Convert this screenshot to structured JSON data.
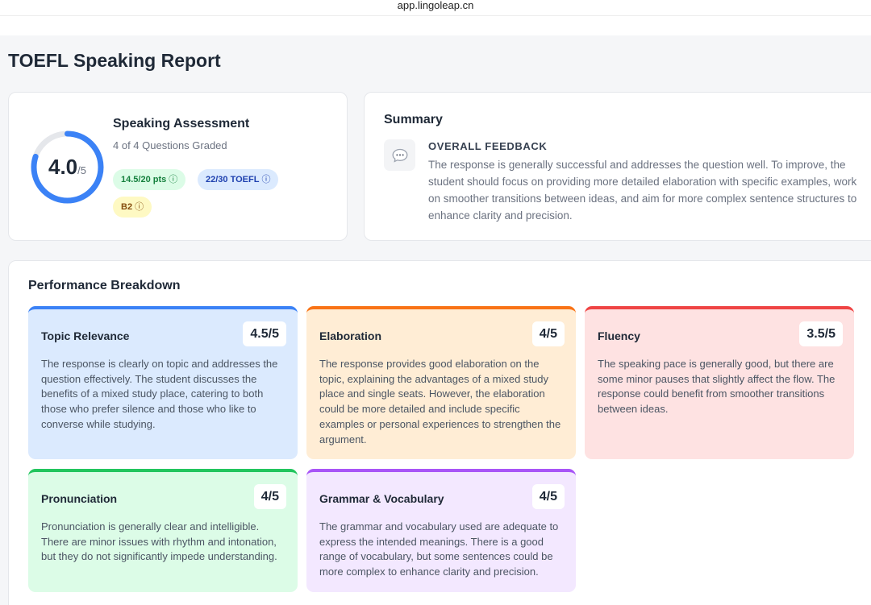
{
  "browser": {
    "url": "app.lingoleap.cn"
  },
  "page": {
    "title": "TOEFL Speaking Report"
  },
  "assessment": {
    "score": "4.0",
    "score_max": "/5",
    "score_fraction": 0.8,
    "title": "Speaking Assessment",
    "subtitle": "4 of 4 Questions Graded",
    "badges": [
      {
        "label": "14.5/20 pts",
        "icon": "info-icon"
      },
      {
        "label": "22/30 TOEFL",
        "icon": "info-icon"
      },
      {
        "label": "B2",
        "icon": "info-icon"
      }
    ],
    "info_glyph": "ⓘ"
  },
  "summary": {
    "title": "Summary",
    "icon": "chat-bubble-icon",
    "feedback_label": "OVERALL FEEDBACK",
    "feedback_text": "The response is generally successful and addresses the question well. To improve, the student should focus on providing more detailed elaboration with specific examples, work on smoother transitions between ideas, and aim for more complex sentence structures to enhance clarity and precision."
  },
  "breakdown": {
    "title": "Performance Breakdown",
    "metrics": [
      {
        "name": "Topic Relevance",
        "score": "4.5/5",
        "color": "#3b82f6",
        "description": "The response is clearly on topic and addresses the question effectively. The student discusses the benefits of a mixed study place, catering to both those who prefer silence and those who like to converse while studying."
      },
      {
        "name": "Elaboration",
        "score": "4/5",
        "color": "#f97316",
        "description": "The response provides good elaboration on the topic, explaining the advantages of a mixed study place and single seats. However, the elaboration could be more detailed and include specific examples or personal experiences to strengthen the argument."
      },
      {
        "name": "Fluency",
        "score": "3.5/5",
        "color": "#ef4444",
        "description": "The speaking pace is generally good, but there are some minor pauses that slightly affect the flow. The response could benefit from smoother transitions between ideas."
      },
      {
        "name": "Pronunciation",
        "score": "4/5",
        "color": "#22c55e",
        "description": "Pronunciation is generally clear and intelligible. There are minor issues with rhythm and intonation, but they do not significantly impede understanding."
      },
      {
        "name": "Grammar & Vocabulary",
        "score": "4/5",
        "color": "#a855f7",
        "description": "The grammar and vocabulary used are adequate to express the intended meanings. There is a good range of vocabulary, but some sentences could be more complex to enhance clarity and precision."
      }
    ]
  }
}
